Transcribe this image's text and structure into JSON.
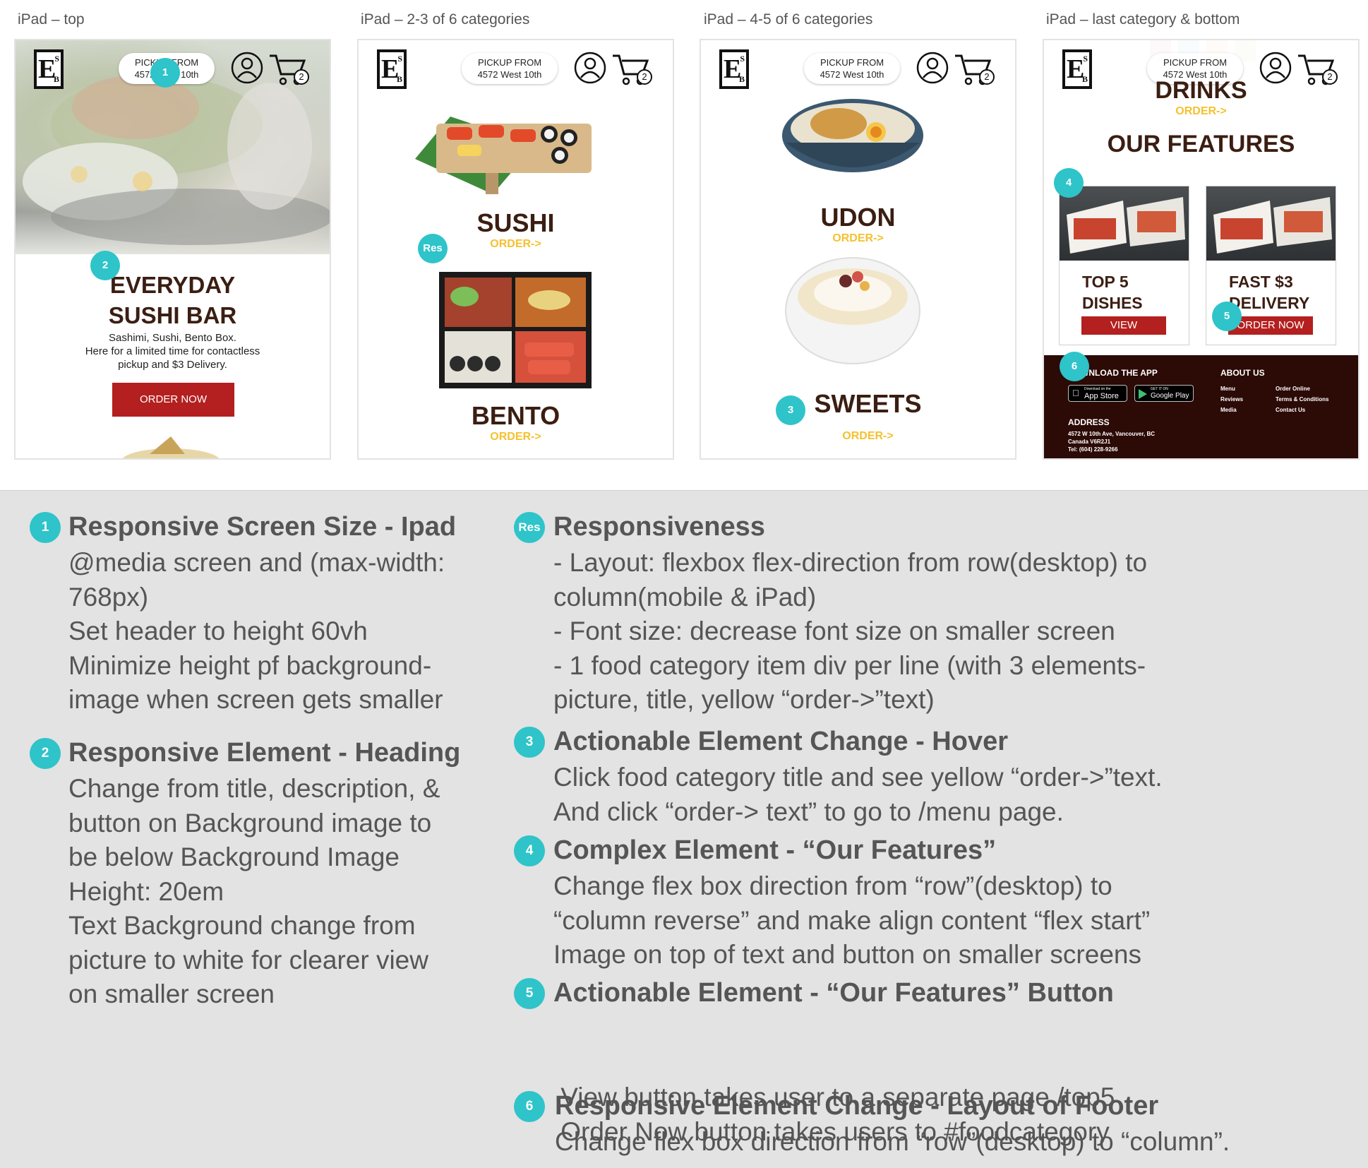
{
  "frames": [
    {
      "label": "iPad – top"
    },
    {
      "label": "iPad – 2-3 of 6 categories"
    },
    {
      "label": "iPad – 4-5 of 6 categories"
    },
    {
      "label": "iPad – last category & bottom"
    }
  ],
  "header": {
    "pickup_line1": "PICKUP FROM",
    "pickup_line2": "4572 West 10th",
    "cart_count": "2",
    "logo_e": "E",
    "logo_s": "S",
    "logo_b": "B"
  },
  "hero": {
    "title_line1": "EVERYDAY",
    "title_line2": "SUSHI BAR",
    "desc_line1": "Sashimi, Sushi, Bento Box.",
    "desc_line2": "Here for a limited time for contactless",
    "desc_line3": "pickup and $3 Delivery.",
    "button": "ORDER NOW"
  },
  "categories": {
    "sushi": "SUSHI",
    "bento": "BENTO",
    "udon": "UDON",
    "sweets": "SWEETS",
    "drinks": "DRINKS",
    "order": "ORDER->"
  },
  "features": {
    "heading": "OUR FEATURES",
    "card1_line1": "TOP 5",
    "card1_line2": "DISHES",
    "card1_button": "VIEW",
    "card2_line1": "FAST $3",
    "card2_line2": "DELIVERY",
    "card2_button": "ORDER NOW"
  },
  "footer": {
    "download": "DOWNLOAD THE APP",
    "appstore_small": "Download on the",
    "appstore": "App Store",
    "googleplay_small": "GET IT ON",
    "googleplay": "Google Play",
    "about": "ABOUT US",
    "links": [
      "Menu",
      "Reviews",
      "Media",
      "Order Online",
      "Terms & Conditions",
      "Contact Us"
    ],
    "address_heading": "ADDRESS",
    "address_line1": "4572 W 10th Ave, Vancouver, BC",
    "address_line2": "Canada V6R2J1",
    "address_line3": "Tel: (604) 228-9266"
  },
  "badges": {
    "b1": "1",
    "b2": "2",
    "b3": "3",
    "b4": "4",
    "b5": "5",
    "b6": "6",
    "res": "Res"
  },
  "notes": {
    "n1_title": "Responsive Screen Size - Ipad",
    "n1_lines": [
      "@media screen and (max-width:",
      "768px)",
      "Set header to height 60vh",
      "Minimize height pf background-",
      "image when screen gets smaller"
    ],
    "n2_title": "Responsive Element - Heading",
    "n2_lines": [
      "Change from title, description, &",
      "button on Background image to",
      "be below Background Image",
      "Height: 20em",
      "Text Background change from",
      "picture to white for clearer view",
      "on smaller screen"
    ],
    "res_title": "Responsiveness",
    "res_lines": [
      "- Layout: flexbox flex-direction from row(desktop) to",
      "column(mobile & iPad)",
      "- Font size: decrease font size on smaller screen",
      "- 1 food category item div per line (with 3 elements-",
      "picture, title, yellow “order->”text)"
    ],
    "n3_title": "Actionable Element Change - Hover",
    "n3_lines": [
      "Click food category title and see yellow “order->”text.",
      "And click “order-> text” to go to /menu page."
    ],
    "n4_title": "Complex Element - “Our Features”",
    "n4_lines": [
      "Change flex box direction from “row”(desktop) to",
      "“column reverse” and make align content “flex start”",
      "Image on top of text and button on smaller screens"
    ],
    "n5_title": "Actionable Element - “Our Features” Button",
    "n5_lines": [
      " View button takes user to a separate page /top5",
      " Order Now button takes users to #foodcategory"
    ],
    "n6_title": "Responsive Element Change - Layout of Footer",
    "n6_lines": [
      "Change flex box direction from “row”(desktop) to “column”."
    ]
  }
}
